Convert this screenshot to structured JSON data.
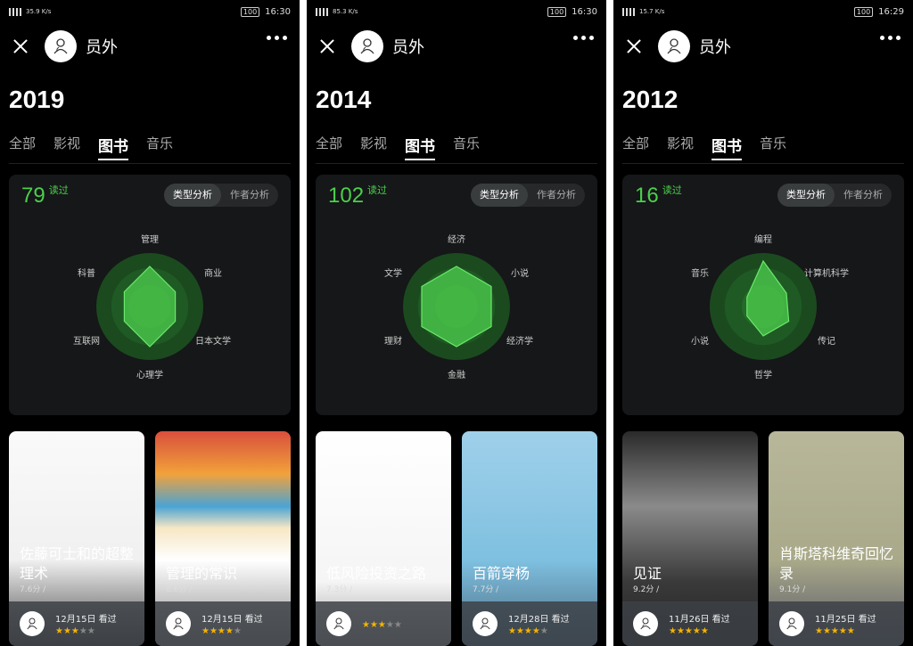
{
  "colors": {
    "accent_green": "#4ccf4c"
  },
  "user": {
    "name": "员外",
    "avatar_icon": "sketch-avatar-icon"
  },
  "status_bar": [
    {
      "speed": "35.9\nK/s",
      "battery": "100",
      "time": "16:30"
    },
    {
      "speed": "85.3\nK/s",
      "battery": "100",
      "time": "16:30"
    },
    {
      "speed": "15.7\nK/s",
      "battery": "100",
      "time": "16:29"
    }
  ],
  "tabs": [
    "全部",
    "影视",
    "图书",
    "音乐"
  ],
  "seg": {
    "type": "类型分析",
    "author": "作者分析"
  },
  "read_label": "读过",
  "panels": [
    {
      "year": "2019",
      "count": "79",
      "radar": [
        "管理",
        "商业",
        "日本文学",
        "心理学",
        "互联网",
        "科普"
      ],
      "radar_values": [
        0.75,
        0.55,
        0.55,
        0.75,
        0.55,
        0.55
      ],
      "books": [
        {
          "title": "佐藤可士和的超整理术",
          "score": "7.6分 /",
          "date": "12月15日 看过",
          "stars": 3
        },
        {
          "title": "管理的常识",
          "score": "8.6分 /",
          "date": "12月15日 看过",
          "stars": 4
        }
      ]
    },
    {
      "year": "2014",
      "count": "102",
      "radar": [
        "经济",
        "小说",
        "经济学",
        "金融",
        "理财",
        "文学"
      ],
      "radar_values": [
        0.75,
        0.75,
        0.75,
        0.75,
        0.75,
        0.75
      ],
      "books": [
        {
          "title": "低风险投资之路",
          "score": "7.3分 /",
          "date": "",
          "stars": 3
        },
        {
          "title": "百箭穿杨",
          "score": "7.7分 /",
          "date": "12月28日 看过",
          "stars": 4
        }
      ]
    },
    {
      "year": "2012",
      "count": "16",
      "radar": [
        "编程",
        "计算机科学",
        "传记",
        "哲学",
        "小说",
        "音乐"
      ],
      "radar_values": [
        0.85,
        0.5,
        0.55,
        0.55,
        0.35,
        0.35
      ],
      "books": [
        {
          "title": "见证",
          "score": "9.2分 /",
          "date": "11月26日 看过",
          "stars": 5
        },
        {
          "title": "肖斯塔科维奇回忆录",
          "score": "9.1分 /",
          "date": "11月25日 看过",
          "stars": 5
        }
      ]
    }
  ]
}
